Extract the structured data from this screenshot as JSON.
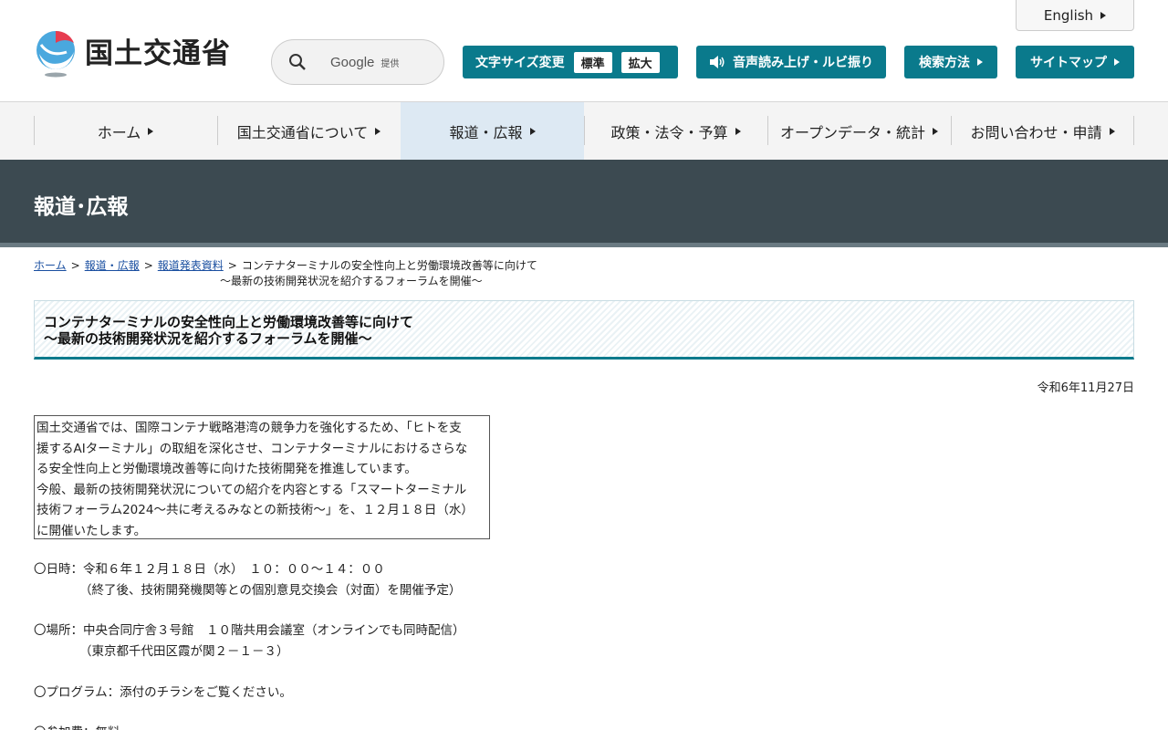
{
  "header": {
    "logo_text": "国土交通省",
    "search": {
      "provider": "Google",
      "provider_suffix": "提供"
    },
    "english_label": "English",
    "font_size": {
      "label": "文字サイズ変更",
      "standard": "標準",
      "large": "拡大"
    },
    "audio_label": "音声読み上げ・ルビ振り",
    "search_method_label": "検索方法",
    "sitemap_label": "サイトマップ"
  },
  "nav": {
    "items": [
      {
        "label": "ホーム"
      },
      {
        "label": "国土交通省について"
      },
      {
        "label": "報道・広報"
      },
      {
        "label": "政策・法令・予算"
      },
      {
        "label": "オープンデータ・統計"
      },
      {
        "label": "お問い合わせ・申請"
      }
    ]
  },
  "banner": {
    "title": "報道･広報"
  },
  "breadcrumb": {
    "home": "ホーム",
    "press": "報道・広報",
    "releases": "報道発表資料",
    "sep": ">",
    "current_line1": "コンテナターミナルの安全性向上と労働環境改善等に向けて",
    "current_line2": "～最新の技術開発状況を紹介するフォーラムを開催～"
  },
  "article": {
    "title_line1": "コンテナターミナルの安全性向上と労働環境改善等に向けて",
    "title_line2": "～最新の技術開発状況を紹介するフォーラムを開催～",
    "date": "令和6年11月27日",
    "intro": [
      "国土交通省では、国際コンテナ戦略港湾の競争力を強化するため、「ヒトを支",
      "援するAIターミナル」の取組を深化させ、コンテナターミナルにおけるさらな",
      "る安全性向上と労働環境改善等に向けた技術開発を推進しています。",
      "今般、最新の技術開発状況についての紹介を内容とする「スマートターミナル",
      "技術フォーラム2024～共に考えるみなとの新技術～」を、１２月１８日（水）",
      "に開催いたします。"
    ],
    "datetime": "〇日時：令和６年１２月１８日（水）　１０：００～１４：００",
    "datetime_note": "（終了後、技術開発機関等との個別意見交換会（対面）を開催予定）",
    "place": "〇場所：中央合同庁舎３号館　１０階共用会議室（オンラインでも同時配信）",
    "place_note": "（東京都千代田区霞が関２－１－３）",
    "program": "〇プログラム：添付のチラシをご覧ください。",
    "fee": "〇参加費：無料"
  }
}
